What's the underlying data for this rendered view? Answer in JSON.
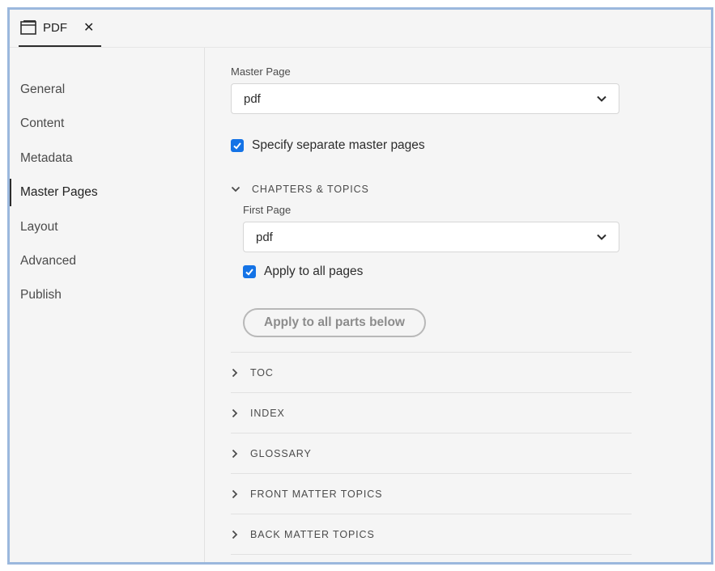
{
  "tab": {
    "label": "PDF",
    "close_glyph": "✕",
    "icon": "window-icon"
  },
  "sidebar": {
    "items": [
      {
        "label": "General"
      },
      {
        "label": "Content"
      },
      {
        "label": "Metadata"
      },
      {
        "label": "Master Pages",
        "active": true
      },
      {
        "label": "Layout"
      },
      {
        "label": "Advanced"
      },
      {
        "label": "Publish"
      }
    ]
  },
  "main": {
    "master_page": {
      "label": "Master Page",
      "value": "pdf"
    },
    "separate_master_pages": {
      "label": "Specify separate master pages",
      "checked": true
    },
    "chapters_topics": {
      "title": "CHAPTERS & TOPICS",
      "expanded": true,
      "first_page": {
        "label": "First Page",
        "value": "pdf"
      },
      "apply_all_pages": {
        "label": "Apply to all pages",
        "checked": true
      },
      "apply_button": "Apply to all parts below"
    },
    "sections": [
      {
        "title": "TOC"
      },
      {
        "title": "INDEX"
      },
      {
        "title": "GLOSSARY"
      },
      {
        "title": "FRONT MATTER TOPICS"
      },
      {
        "title": "BACK MATTER TOPICS"
      }
    ]
  },
  "colors": {
    "accent": "#1473e6",
    "frame_border": "#9bb8dd",
    "background": "#f5f5f5"
  }
}
